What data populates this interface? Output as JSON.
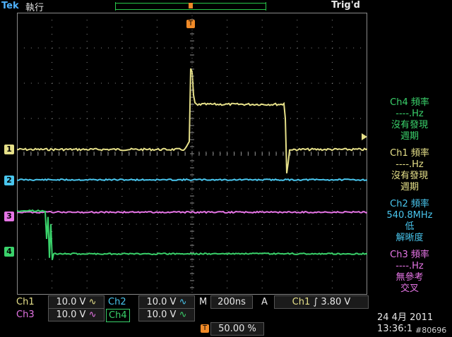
{
  "header": {
    "brand": "Tek",
    "mode": "執行",
    "trigger_state": "Trig'd",
    "trigger_marker": "T"
  },
  "colors": {
    "ch1": "#e6e089",
    "ch2": "#49c6ee",
    "ch3": "#e675e6",
    "ch4": "#3ad26b",
    "grid": "#8a8a8a",
    "trigger": "#f08a28"
  },
  "markers": {
    "ch1": "1",
    "ch2": "2",
    "ch3": "3",
    "ch4": "4"
  },
  "measurements": [
    {
      "title": "Ch4 頻率",
      "value": "----.Hz",
      "note1": "沒有發現",
      "note2": "週期",
      "color": "#3ad26b"
    },
    {
      "title": "Ch1 頻率",
      "value": "----.Hz",
      "note1": "沒有發現",
      "note2": "週期",
      "color": "#e6e089"
    },
    {
      "title": "Ch2 頻率",
      "value": "540.8MHz",
      "note1": "低",
      "note2": "解晰度",
      "color": "#49c6ee"
    },
    {
      "title": "Ch3 頻率",
      "value": "----.Hz",
      "note1": "無參考",
      "note2": "交叉",
      "color": "#e675e6"
    }
  ],
  "status": {
    "ch1_label": "Ch1",
    "ch1_scale": "10.0 V",
    "ch2_label": "Ch2",
    "ch2_scale": "10.0 V",
    "ch3_label": "Ch3",
    "ch3_scale": "10.0 V",
    "ch4_label": "Ch4",
    "ch4_scale": "10.0 V",
    "coupling_symbol": "∿",
    "timebase_label": "M",
    "timebase": "200ns",
    "trigger_label": "A",
    "trigger_source": "Ch1",
    "trigger_slope": "∫",
    "trigger_level": "3.80 V",
    "position_icon": "T",
    "position": "50.00 %",
    "date": "24 4月  2011",
    "time": "13:36:1",
    "watermark": "#80696"
  }
}
